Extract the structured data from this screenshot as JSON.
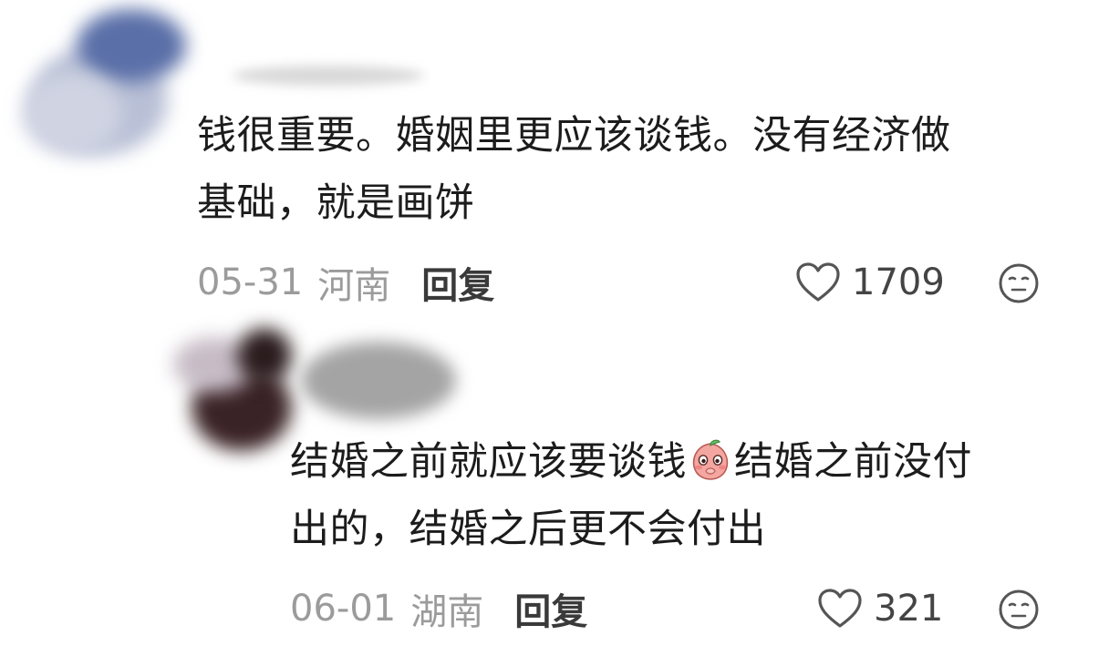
{
  "comments": [
    {
      "text_line1": "钱很重要。婚姻里更应该谈钱。没有经济做",
      "text_line2": "基础，就是画饼",
      "date": "05-31",
      "location": "河南",
      "reply_label": "回复",
      "likes": "1709"
    },
    {
      "text_part1": "结婚之前就应该要谈钱",
      "text_part2": "结婚之前没付",
      "text_line2": "出的，结婚之后更不会付出",
      "date": "06-01",
      "location": "湖南",
      "reply_label": "回复",
      "likes": "321",
      "emoji": "blushing-peach-emoji"
    }
  ],
  "icons": {
    "like": "heart-outline-icon",
    "react": "neutral-face-icon"
  },
  "colors": {
    "text": "#1c1c1c",
    "meta": "#9b9b9b",
    "reply": "#3a3a3a",
    "icon": "#555555"
  }
}
